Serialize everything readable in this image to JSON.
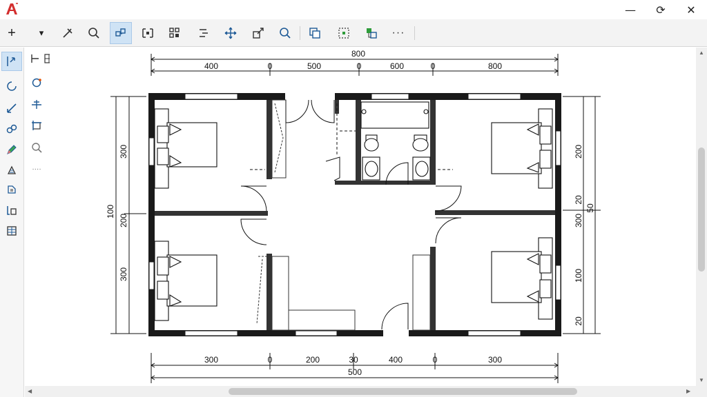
{
  "window": {
    "minimize": "—",
    "restore": "⟳",
    "close": "✕"
  },
  "toolbar": {
    "add_label": "+",
    "dropdown_label": "▾",
    "more_label": "···"
  },
  "subpalette": {
    "collapse_label": "‹"
  },
  "dimensions": {
    "top_overall": "800",
    "top_segments": [
      "400",
      "0",
      "500",
      "0",
      "600",
      "0",
      "800"
    ],
    "bottom_overall": "500",
    "bottom_segments": [
      "300",
      "0",
      "200",
      "30",
      "400",
      "0",
      "300"
    ],
    "left_overall": "100",
    "left_segments": [
      "300",
      "200",
      "300"
    ],
    "right_overall": "50",
    "right_segments": [
      "200",
      "20",
      "300",
      "100",
      "20"
    ]
  },
  "colors": {
    "accent": "#d32f2f",
    "active": "#cfe3f5",
    "wall": "#1a1a1a",
    "toolbar_bg": "#f3f3f3"
  }
}
